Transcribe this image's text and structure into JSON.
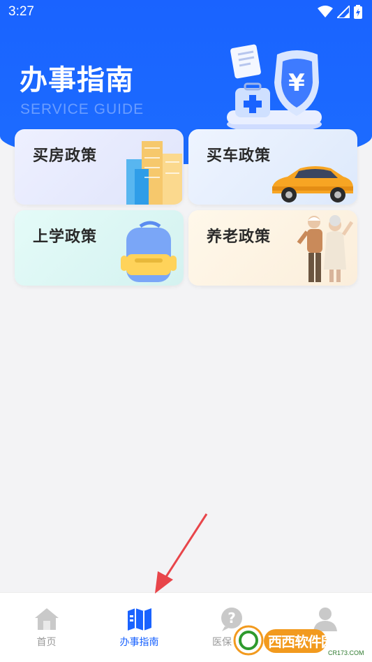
{
  "status_bar": {
    "time": "3:27"
  },
  "header": {
    "title": "办事指南",
    "subtitle": "SERVICE GUIDE"
  },
  "cards": [
    {
      "label": "买房政策",
      "art": "buildings-illustration"
    },
    {
      "label": "买车政策",
      "art": "car-illustration"
    },
    {
      "label": "上学政策",
      "art": "backpack-illustration"
    },
    {
      "label": "养老政策",
      "art": "elderly-couple-illustration"
    }
  ],
  "tab_bar": {
    "tabs": [
      {
        "label": "首页",
        "icon": "home-icon",
        "active": false
      },
      {
        "label": "办事指南",
        "icon": "map-guide-icon",
        "active": true
      },
      {
        "label": "医保",
        "icon": "question-bubble-icon",
        "active": false
      },
      {
        "label": "",
        "icon": "user-icon",
        "active": false
      }
    ]
  },
  "watermark": {
    "brand": "西西软件园",
    "site": "CR173.COM"
  },
  "colors": {
    "primary": "#1a63ff",
    "background": "#f3f3f5",
    "annotation_arrow": "#e8454a"
  }
}
